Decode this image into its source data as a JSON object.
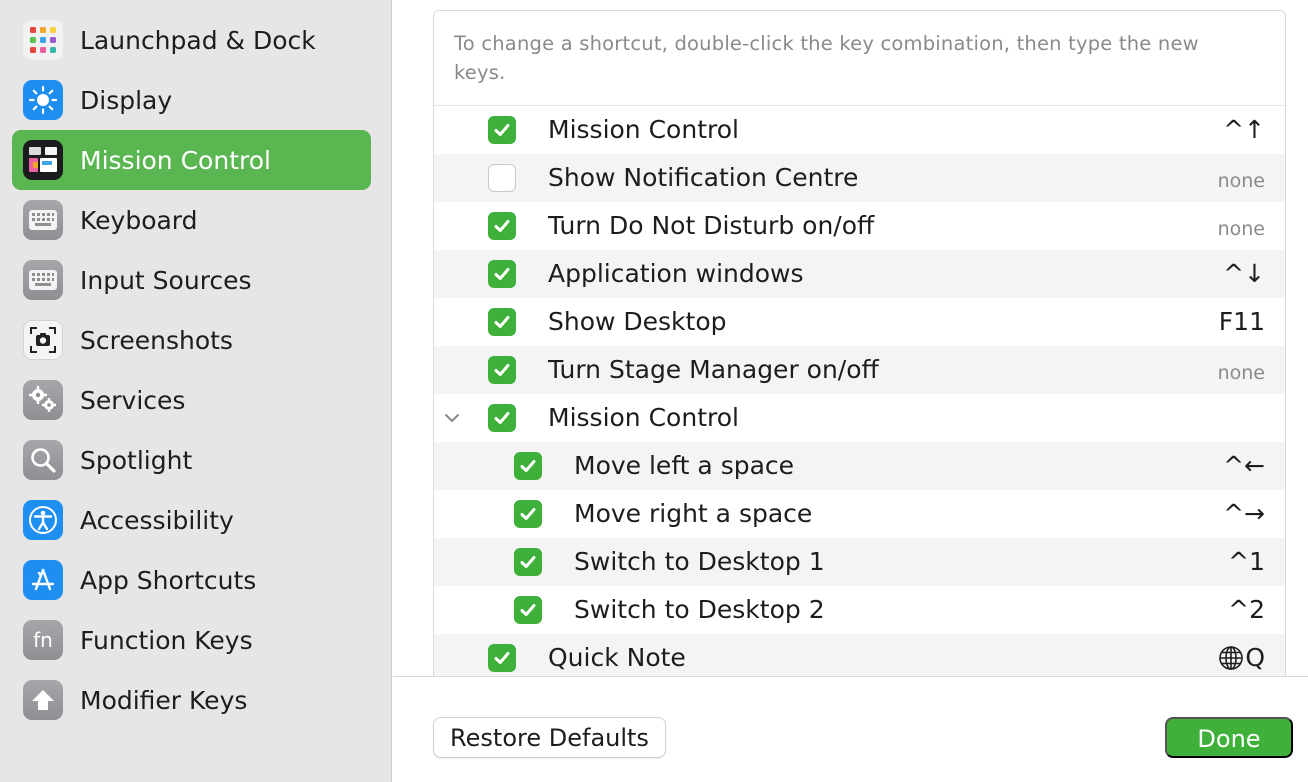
{
  "sidebar": {
    "items": [
      {
        "label": "Launchpad & Dock",
        "icon": "launchpad-icon"
      },
      {
        "label": "Display",
        "icon": "display-icon"
      },
      {
        "label": "Mission Control",
        "icon": "mission-control-icon",
        "selected": true
      },
      {
        "label": "Keyboard",
        "icon": "keyboard-icon"
      },
      {
        "label": "Input Sources",
        "icon": "input-sources-icon"
      },
      {
        "label": "Screenshots",
        "icon": "screenshots-icon"
      },
      {
        "label": "Services",
        "icon": "services-icon"
      },
      {
        "label": "Spotlight",
        "icon": "spotlight-icon"
      },
      {
        "label": "Accessibility",
        "icon": "accessibility-icon"
      },
      {
        "label": "App Shortcuts",
        "icon": "app-shortcuts-icon"
      },
      {
        "label": "Function Keys",
        "icon": "function-keys-icon"
      },
      {
        "label": "Modifier Keys",
        "icon": "modifier-keys-icon"
      }
    ]
  },
  "main": {
    "hint": "To change a shortcut, double-click the key combination, then type the new keys.",
    "shortcuts": [
      {
        "label": "Mission Control",
        "checked": true,
        "key": "^↑"
      },
      {
        "label": "Show Notification Centre",
        "checked": false,
        "key": "none"
      },
      {
        "label": "Turn Do Not Disturb on/off",
        "checked": true,
        "key": "none"
      },
      {
        "label": "Application windows",
        "checked": true,
        "key": "^↓"
      },
      {
        "label": "Show Desktop",
        "checked": true,
        "key": "F11"
      },
      {
        "label": "Turn Stage Manager on/off",
        "checked": true,
        "key": "none"
      },
      {
        "label": "Mission Control",
        "checked": true,
        "key": "",
        "group": true,
        "expanded": true
      },
      {
        "label": "Move left a space",
        "checked": true,
        "key": "^←",
        "child": true
      },
      {
        "label": "Move right a space",
        "checked": true,
        "key": "^→",
        "child": true
      },
      {
        "label": "Switch to Desktop 1",
        "checked": true,
        "key": "^1",
        "child": true
      },
      {
        "label": "Switch to Desktop 2",
        "checked": true,
        "key": "^2",
        "child": true
      },
      {
        "label": "Quick Note",
        "checked": true,
        "key": "Q",
        "key_prefix_icon": "globe-icon"
      }
    ]
  },
  "footer": {
    "restore_label": "Restore Defaults",
    "done_label": "Done"
  },
  "colors": {
    "accent": "#5ab650",
    "checkbox": "#3fb13a",
    "sidebar_bg": "#e6e6e6"
  }
}
